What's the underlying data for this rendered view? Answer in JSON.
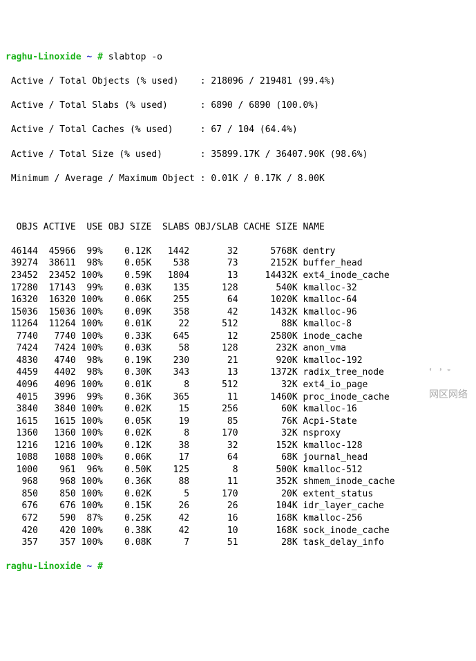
{
  "prompt": {
    "user_host": "raghu-Linoxide",
    "path": "~",
    "hash": "#",
    "command": "slabtop -o"
  },
  "summary": {
    "line1_label": " Active / Total Objects (% used)    : ",
    "line1_value": "218096 / 219481 (99.4%)",
    "line2_label": " Active / Total Slabs (% used)      : ",
    "line2_value": "6890 / 6890 (100.0%)",
    "line3_label": " Active / Total Caches (% used)     : ",
    "line3_value": "67 / 104 (64.4%)",
    "line4_label": " Active / Total Size (% used)       : ",
    "line4_value": "35899.17K / 36407.90K (98.6%)",
    "line5_label": " Minimum / Average / Maximum Object : ",
    "line5_value": "0.01K / 0.17K / 8.00K"
  },
  "header": "  OBJS ACTIVE  USE OBJ SIZE  SLABS OBJ/SLAB CACHE SIZE NAME",
  "rows": [
    {
      "objs": "46144",
      "active": "45966",
      "use": "99%",
      "objsize": "0.12K",
      "slabs": "1442",
      "objslab": "32",
      "cachesize": "5768K",
      "name": "dentry"
    },
    {
      "objs": "39274",
      "active": "38611",
      "use": "98%",
      "objsize": "0.05K",
      "slabs": "538",
      "objslab": "73",
      "cachesize": "2152K",
      "name": "buffer_head"
    },
    {
      "objs": "23452",
      "active": "23452",
      "use": "100%",
      "objsize": "0.59K",
      "slabs": "1804",
      "objslab": "13",
      "cachesize": "14432K",
      "name": "ext4_inode_cache"
    },
    {
      "objs": "17280",
      "active": "17143",
      "use": "99%",
      "objsize": "0.03K",
      "slabs": "135",
      "objslab": "128",
      "cachesize": "540K",
      "name": "kmalloc-32"
    },
    {
      "objs": "16320",
      "active": "16320",
      "use": "100%",
      "objsize": "0.06K",
      "slabs": "255",
      "objslab": "64",
      "cachesize": "1020K",
      "name": "kmalloc-64"
    },
    {
      "objs": "15036",
      "active": "15036",
      "use": "100%",
      "objsize": "0.09K",
      "slabs": "358",
      "objslab": "42",
      "cachesize": "1432K",
      "name": "kmalloc-96"
    },
    {
      "objs": "11264",
      "active": "11264",
      "use": "100%",
      "objsize": "0.01K",
      "slabs": "22",
      "objslab": "512",
      "cachesize": "88K",
      "name": "kmalloc-8"
    },
    {
      "objs": "7740",
      "active": "7740",
      "use": "100%",
      "objsize": "0.33K",
      "slabs": "645",
      "objslab": "12",
      "cachesize": "2580K",
      "name": "inode_cache"
    },
    {
      "objs": "7424",
      "active": "7424",
      "use": "100%",
      "objsize": "0.03K",
      "slabs": "58",
      "objslab": "128",
      "cachesize": "232K",
      "name": "anon_vma"
    },
    {
      "objs": "4830",
      "active": "4740",
      "use": "98%",
      "objsize": "0.19K",
      "slabs": "230",
      "objslab": "21",
      "cachesize": "920K",
      "name": "kmalloc-192"
    },
    {
      "objs": "4459",
      "active": "4402",
      "use": "98%",
      "objsize": "0.30K",
      "slabs": "343",
      "objslab": "13",
      "cachesize": "1372K",
      "name": "radix_tree_node"
    },
    {
      "objs": "4096",
      "active": "4096",
      "use": "100%",
      "objsize": "0.01K",
      "slabs": "8",
      "objslab": "512",
      "cachesize": "32K",
      "name": "ext4_io_page"
    },
    {
      "objs": "4015",
      "active": "3996",
      "use": "99%",
      "objsize": "0.36K",
      "slabs": "365",
      "objslab": "11",
      "cachesize": "1460K",
      "name": "proc_inode_cache"
    },
    {
      "objs": "3840",
      "active": "3840",
      "use": "100%",
      "objsize": "0.02K",
      "slabs": "15",
      "objslab": "256",
      "cachesize": "60K",
      "name": "kmalloc-16"
    },
    {
      "objs": "1615",
      "active": "1615",
      "use": "100%",
      "objsize": "0.05K",
      "slabs": "19",
      "objslab": "85",
      "cachesize": "76K",
      "name": "Acpi-State"
    },
    {
      "objs": "1360",
      "active": "1360",
      "use": "100%",
      "objsize": "0.02K",
      "slabs": "8",
      "objslab": "170",
      "cachesize": "32K",
      "name": "nsproxy"
    },
    {
      "objs": "1216",
      "active": "1216",
      "use": "100%",
      "objsize": "0.12K",
      "slabs": "38",
      "objslab": "32",
      "cachesize": "152K",
      "name": "kmalloc-128"
    },
    {
      "objs": "1088",
      "active": "1088",
      "use": "100%",
      "objsize": "0.06K",
      "slabs": "17",
      "objslab": "64",
      "cachesize": "68K",
      "name": "journal_head"
    },
    {
      "objs": "1000",
      "active": "961",
      "use": "96%",
      "objsize": "0.50K",
      "slabs": "125",
      "objslab": "8",
      "cachesize": "500K",
      "name": "kmalloc-512"
    },
    {
      "objs": "968",
      "active": "968",
      "use": "100%",
      "objsize": "0.36K",
      "slabs": "88",
      "objslab": "11",
      "cachesize": "352K",
      "name": "shmem_inode_cache"
    },
    {
      "objs": "850",
      "active": "850",
      "use": "100%",
      "objsize": "0.02K",
      "slabs": "5",
      "objslab": "170",
      "cachesize": "20K",
      "name": "extent_status"
    },
    {
      "objs": "676",
      "active": "676",
      "use": "100%",
      "objsize": "0.15K",
      "slabs": "26",
      "objslab": "26",
      "cachesize": "104K",
      "name": "idr_layer_cache"
    },
    {
      "objs": "672",
      "active": "590",
      "use": "87%",
      "objsize": "0.25K",
      "slabs": "42",
      "objslab": "16",
      "cachesize": "168K",
      "name": "kmalloc-256"
    },
    {
      "objs": "420",
      "active": "420",
      "use": "100%",
      "objsize": "0.38K",
      "slabs": "42",
      "objslab": "10",
      "cachesize": "168K",
      "name": "sock_inode_cache"
    },
    {
      "objs": "357",
      "active": "357",
      "use": "100%",
      "objsize": "0.08K",
      "slabs": "7",
      "objslab": "51",
      "cachesize": "28K",
      "name": "task_delay_info"
    }
  ],
  "watermark": "网区网络"
}
